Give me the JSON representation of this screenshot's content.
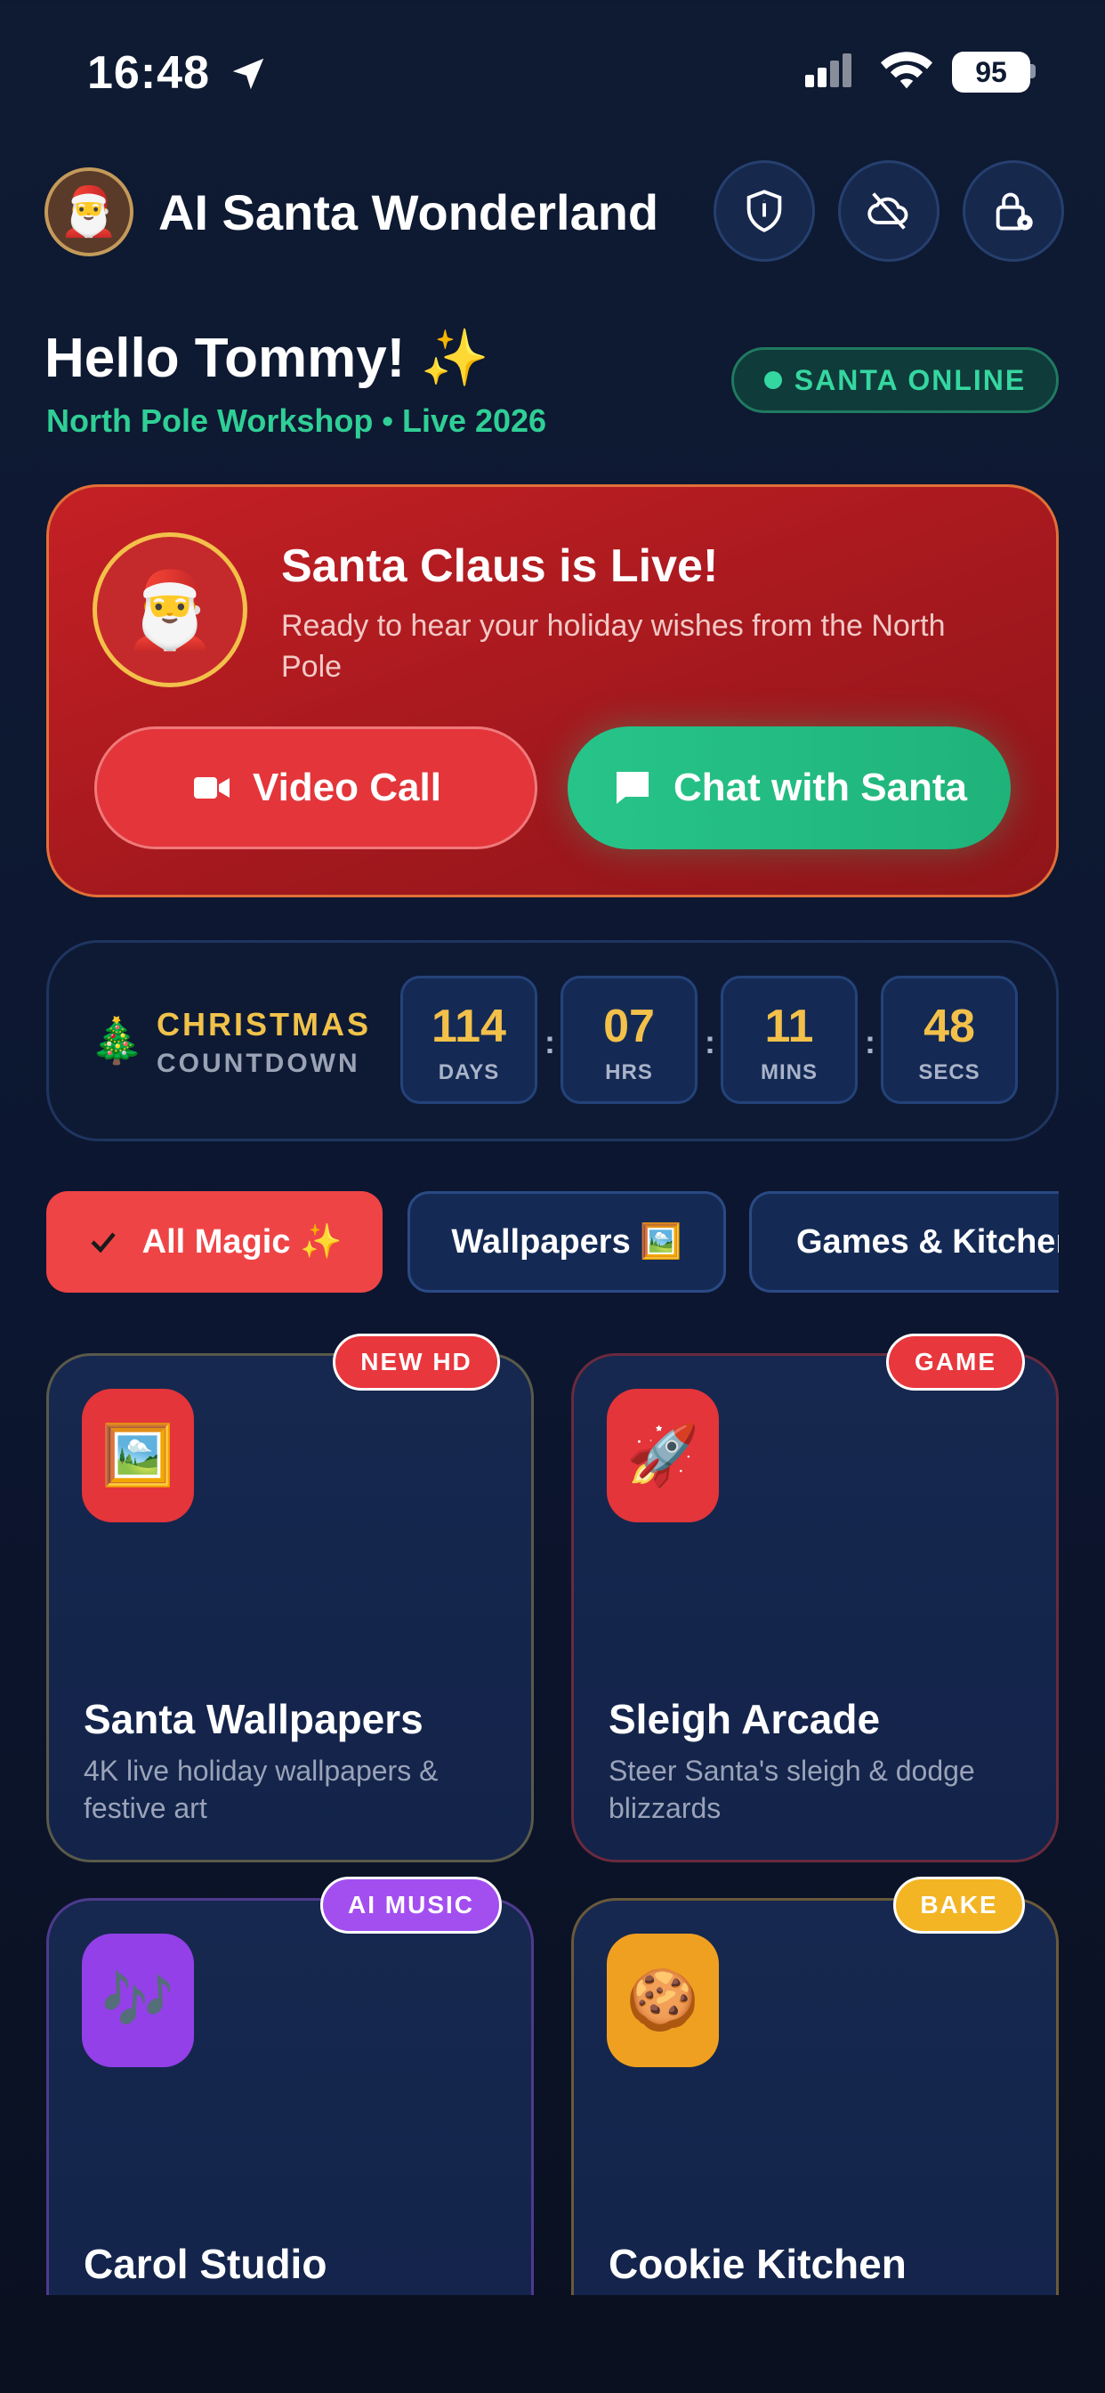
{
  "status_bar": {
    "time": "16:48",
    "battery": "95"
  },
  "header": {
    "title": "AI Santa Wonderland",
    "avatar_emoji": "🎅",
    "buttons": [
      "shield-icon",
      "cloud-off-icon",
      "lock-icon"
    ]
  },
  "greeting": {
    "hello": "Hello Tommy! ✨",
    "subline": "North Pole Workshop • Live 2026",
    "online_badge": "SANTA ONLINE"
  },
  "live_card": {
    "avatar_emoji": "🎅",
    "title": "Santa Claus is Live!",
    "description": "Ready to hear your holiday wishes from the North Pole",
    "video_button": "Video Call",
    "chat_button": "Chat with Santa"
  },
  "countdown": {
    "icon": "🎄",
    "label_line1": "CHRISTMAS",
    "label_line2": "COUNTDOWN",
    "units": [
      {
        "value": "114",
        "label": "DAYS"
      },
      {
        "value": "07",
        "label": "HRS"
      },
      {
        "value": "11",
        "label": "MINS"
      },
      {
        "value": "48",
        "label": "SECS"
      }
    ],
    "separator": ":"
  },
  "filters": [
    {
      "label": "All Magic ✨",
      "active": true
    },
    {
      "label": "Wallpapers 🖼️",
      "active": false
    },
    {
      "label": "Games & Kitchen",
      "active": false
    }
  ],
  "features": [
    {
      "badge": "NEW HD",
      "icon": "🖼️",
      "title": "Santa Wallpapers",
      "description": "4K live holiday wallpapers & festive art",
      "accent": "#e8373d"
    },
    {
      "badge": "GAME",
      "icon": "🚀",
      "title": "Sleigh Arcade",
      "description": "Steer Santa's sleigh & dodge blizzards",
      "accent": "#e8373d"
    },
    {
      "badge": "AI MUSIC",
      "icon": "🎶",
      "title": "Carol Studio",
      "description": "",
      "accent": "#a34ff0"
    },
    {
      "badge": "BAKE",
      "icon": "🍪",
      "title": "Cookie Kitchen",
      "description": "",
      "accent": "#f3b524"
    }
  ],
  "colors": {
    "accent_red": "#ef4446",
    "accent_green": "#27c48a",
    "gold": "#f3c04a",
    "bg": "#0f1a33"
  }
}
